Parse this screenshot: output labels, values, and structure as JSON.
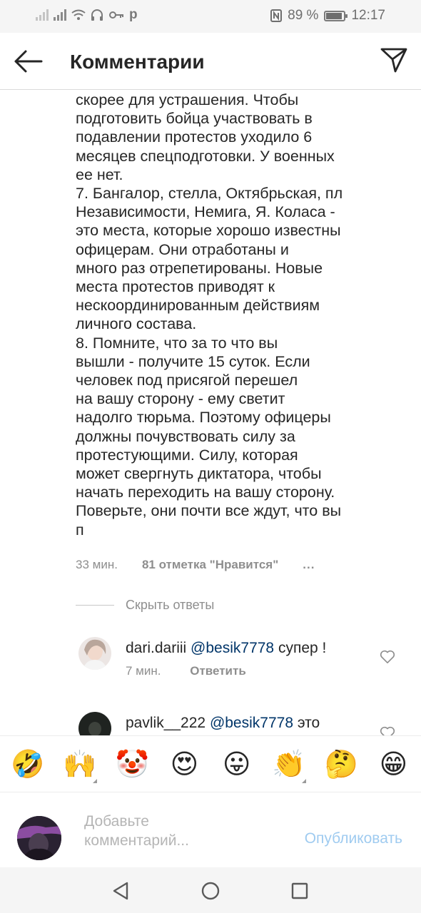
{
  "status_bar": {
    "carrier": "р",
    "battery_percent": "89 %",
    "battery_level": 0.89,
    "time": "12:17",
    "icons": [
      "signal-icon",
      "wifi-icon",
      "headphones-icon",
      "key-icon",
      "nfc-icon",
      "battery-icon"
    ]
  },
  "header": {
    "title": "Комментарии",
    "back_icon": "arrow-left-icon",
    "send_icon": "paper-plane-icon"
  },
  "comment": {
    "text": "скорее для устрашения. Чтобы\nподготовить бойца участвовать в\nподавлении протестов уходило 6\nмесяцев спецподготовки. У военных\nее нет.\n7. Бангалор, стелла, Октябрьская, пл\nНезависимости, Немига, Я. Коласа -\nэто места, которые хорошо известны\nофицерам. Они отработаны и\nмного раз отрепетированы. Новые\nместа протестов приводят к\nнескоординированным действиям\nличного состава.\n8. Помните, что за то что вы\nвышли - получите 15 суток. Если\nчеловек под присягой перешел\nна вашу сторону - ему светит\nнадолго тюрьма. Поэтому офицеры\nдолжны почувствовать силу за\nпротестующими. Силу, которая\nможет свергнуть диктатора, чтобы\nначать переходить на вашу сторону.\nПоверьте, они почти все ждут, что вы\nп",
    "time": "33 мин.",
    "likes": "81 отметка \"Нравится\"",
    "more": "..."
  },
  "hide_replies": "Скрыть ответы",
  "replies": [
    {
      "username": "dari.dariii",
      "mention": "@besik7778",
      "text": " супер !",
      "time": "7 мин.",
      "reply_label": "Ответить"
    },
    {
      "username": "pavlik__222",
      "mention": "@besik7778",
      "text": " это"
    }
  ],
  "emoji_bar": [
    "🤣",
    "🙌",
    "🤡",
    "😍",
    "😛",
    "👏",
    "🤔",
    "😁"
  ],
  "composer": {
    "placeholder": "Добавьте\nкомментарий...",
    "publish_label": "Опубликовать"
  },
  "nav_bar": {
    "icons": [
      "back-triangle-icon",
      "home-circle-icon",
      "recents-square-icon"
    ]
  }
}
